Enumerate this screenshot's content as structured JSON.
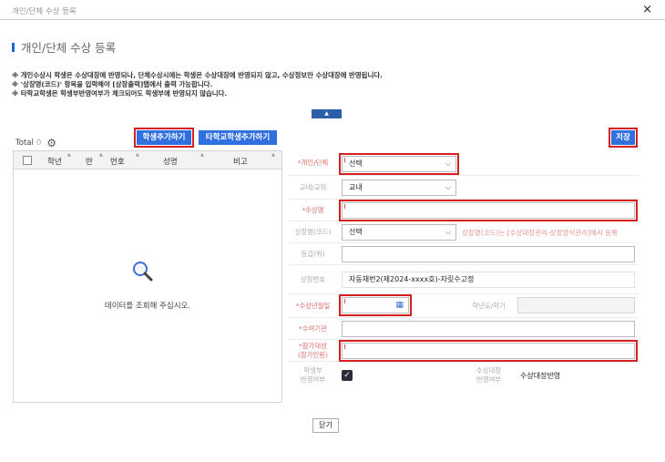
{
  "window": {
    "title": "개인/단체 수상 등록",
    "close": "×"
  },
  "heading": "개인/단체 수상 등록",
  "notes": [
    "※ 개인수상시 학생은 수상대장에 반영되나, 단체수상시에는 학생은 수상대장에 반영되지 않고, 수상정보만 수상대장에 반영됩니다.",
    "※ '상장명(코드)' 항목을 입력해야 [상장출력]탭에서 출력 가능합니다.",
    "※ 타학교학생은 학생부반영여부가 체크되어도 학생부에 반영되지 않습니다."
  ],
  "toggle_label": "▲",
  "list": {
    "total_label": "Total",
    "total_count": "0",
    "add_student_button": "학생추가하기",
    "add_other_school_button": "타학교학생추가하기",
    "columns": [
      "학년",
      "반",
      "번호",
      "성명",
      "비고"
    ],
    "empty_message": "데이터를 조회해 주십시오."
  },
  "save_button": "저장",
  "form": {
    "type_label": "*개인/단체",
    "type_value": "선택",
    "inout_label": "교내/교외",
    "inout_value": "교내",
    "award_name_label": "*수상명",
    "award_name_value": "",
    "cert_code_label": "상장명(코드)",
    "cert_code_value": "선택",
    "cert_code_hint": "상장명(코드)는 [수상대장관리-상장양식관리]에서 등록",
    "grade_label": "등급(위)",
    "grade_value": "",
    "award_no_label": "상장번호",
    "award_no_value": "자동채번2(제2024-xxxx호)-자릿수고정",
    "award_date_label": "*수상년월일",
    "award_date_value": "",
    "year_term_label": "학년도/학기",
    "year_term_value": "",
    "org_label": "*수여기관",
    "org_value": "",
    "participants_label_1": "*참가대상",
    "participants_label_2": "(참가인원)",
    "participants_value": "",
    "record_label_1": "학생부",
    "record_label_2": "반영여부",
    "record_checked": true,
    "ledger_label_1": "수상대장",
    "ledger_label_2": "반영여부",
    "ledger_value": "수상대장반영"
  },
  "close_button": "닫기"
}
